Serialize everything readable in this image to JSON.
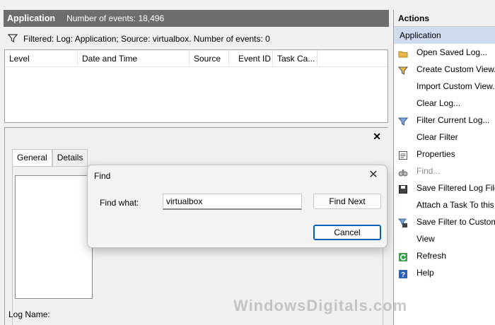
{
  "header": {
    "title": "Application",
    "event_count_label": "Number of events: 18,496"
  },
  "filter_bar": {
    "text": "Filtered: Log: Application; Source: virtualbox. Number of events: 0"
  },
  "event_list": {
    "columns": [
      "Level",
      "Date and Time",
      "Source",
      "Event ID",
      "Task Ca..."
    ]
  },
  "detail_pane": {
    "close_glyph": "✕",
    "tabs": [
      "General",
      "Details"
    ],
    "log_name_label": "Log Name:"
  },
  "find_dialog": {
    "title": "Find",
    "close_glyph": "✕",
    "find_what_label": "Find what:",
    "find_what_value": "virtualbox",
    "find_next_label": "Find Next",
    "cancel_label": "Cancel"
  },
  "actions": {
    "header": "Actions",
    "section": "Application",
    "items": [
      {
        "label": "Open Saved Log...",
        "icon": "folder-icon"
      },
      {
        "label": "Create Custom View...",
        "icon": "funnel-icon"
      },
      {
        "label": "Import Custom View...",
        "icon": ""
      },
      {
        "label": "Clear Log...",
        "icon": ""
      },
      {
        "label": "Filter Current Log...",
        "icon": "funnel-icon"
      },
      {
        "label": "Clear Filter",
        "icon": ""
      },
      {
        "label": "Properties",
        "icon": "properties-icon"
      },
      {
        "label": "Find...",
        "icon": "binoculars-icon"
      },
      {
        "label": "Save Filtered Log File As...",
        "icon": "save-icon"
      },
      {
        "label": "Attach a Task To this Log...",
        "icon": ""
      },
      {
        "label": "Save Filter to Custom View...",
        "icon": "save-filter-icon"
      },
      {
        "label": "View",
        "icon": ""
      },
      {
        "label": "Refresh",
        "icon": "refresh-icon"
      },
      {
        "label": "Help",
        "icon": "help-icon"
      }
    ]
  },
  "watermark": "WindowsDigitals.com",
  "colors": {
    "title_bar": "#6d6d6d",
    "section_highlight": "#cfdcef",
    "accent": "#005fb8"
  }
}
